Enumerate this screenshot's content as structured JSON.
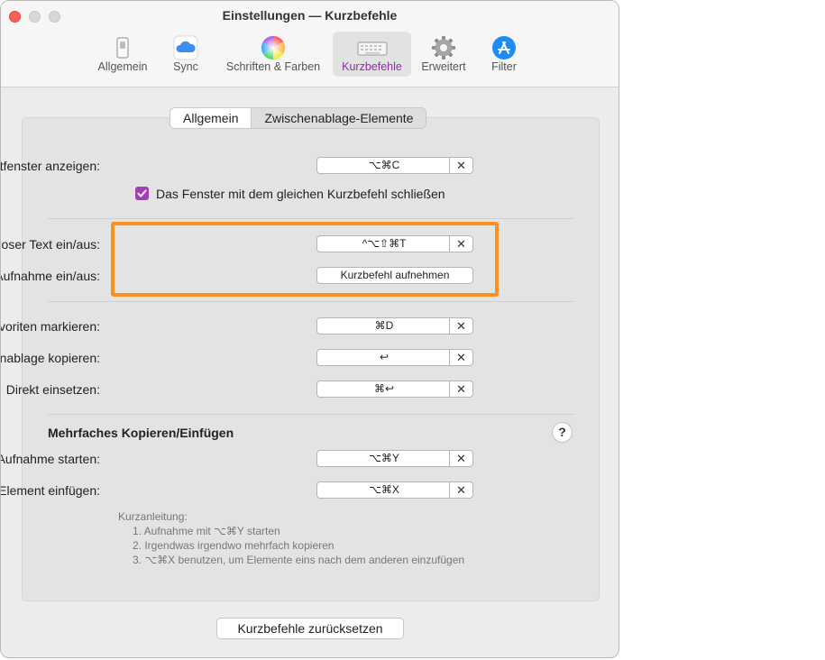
{
  "window": {
    "title": "Einstellungen — Kurzbefehle"
  },
  "toolbar": [
    {
      "label": "Allgemein",
      "icon": "switch-icon"
    },
    {
      "label": "Sync",
      "icon": "cloud-icon"
    },
    {
      "label": "Schriften & Farben",
      "icon": "color-wheel-icon"
    },
    {
      "label": "Kurzbefehle",
      "icon": "keyboard-icon",
      "selected": true
    },
    {
      "label": "Erweitert",
      "icon": "gear-icon"
    },
    {
      "label": "Filter",
      "icon": "app-store-icon"
    }
  ],
  "tabs": {
    "general": "Allgemein",
    "clipboard": "Zwischenablage-Elemente"
  },
  "shortcuts": {
    "main_window": {
      "label": "Hauptfenster anzeigen:",
      "keys": "⌥⌘C"
    },
    "close_checkbox": {
      "label": "Das Fenster mit dem gleichen Kurzbefehl schließen",
      "checked": true
    },
    "plain_text": {
      "label": "Formatloser Text ein/aus:",
      "keys": "^⌥⇧⌘T"
    },
    "recording": {
      "label": "Aufnahme ein/aus:",
      "button": "Kurzbefehl aufnehmen"
    },
    "favorite": {
      "label": "Als Favoriten markieren:",
      "keys": "⌘D"
    },
    "copy": {
      "label": "In die Zwischenablage kopieren:",
      "keys": "↩"
    },
    "paste": {
      "label": "Direkt einsetzen:",
      "keys": "⌘↩"
    }
  },
  "multi": {
    "title": "Mehrfaches Kopieren/Einfügen",
    "help": "?",
    "start": {
      "label": "Aufnahme starten:",
      "keys": "⌥⌘Y"
    },
    "next": {
      "label": "Nächstes Element einfügen:",
      "keys": "⌥⌘X"
    },
    "hint_title": "Kurzanleitung:",
    "hints": [
      "1. Aufnahme mit ⌥⌘Y starten",
      "2. Irgendwas irgendwo mehrfach kopieren",
      "3. ⌥⌘X benutzen, um Elemente eins nach dem anderen einzufügen"
    ]
  },
  "clear_symbol": "✕",
  "reset_button": "Kurzbefehle zurücksetzen",
  "colors": {
    "accent": "#8e2fa9",
    "checkbox": "#a43eb8",
    "highlight": "#f7921e"
  }
}
